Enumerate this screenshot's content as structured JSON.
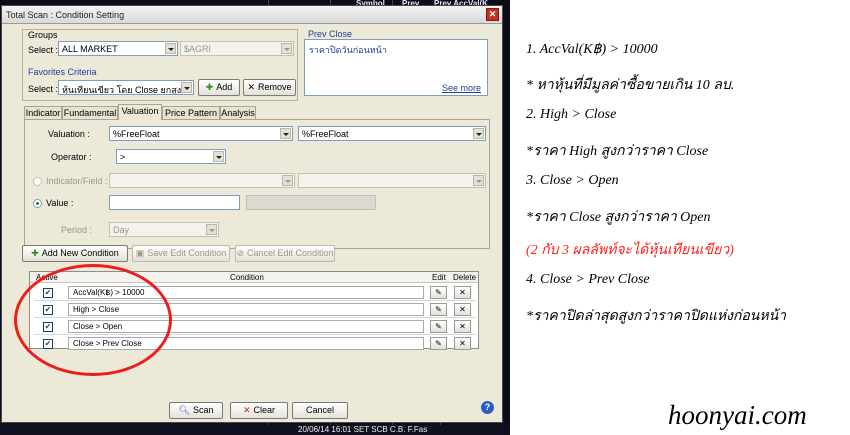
{
  "background_app": {
    "tabs": [
      "Symbol",
      "Prev",
      "Prev AccVal(K"
    ],
    "status_text": "20/06/14 16:01   SET   SCB   C.B. F.Fas"
  },
  "dialog": {
    "title": "Total Scan : Condition Setting",
    "groups": {
      "label": "Groups",
      "select_label": "Select :",
      "market_value": "ALL MARKET",
      "symbol_value": "$AGRI"
    },
    "favorites": {
      "label": "Favorites Criteria",
      "select_label": "Select :",
      "value": "หุ้นเทียนเขียว โดย Close ยกสูงขึ้",
      "add_label": "Add",
      "remove_label": "Remove"
    },
    "prev_close": {
      "label": "Prev Close",
      "description": "ราคาปิดวันก่อนหน้า",
      "see_more": "See more"
    },
    "tabs": [
      "Indicator",
      "Fundamental",
      "Valuation",
      "Price Pattern",
      "Analysis"
    ],
    "active_tab": "Valuation",
    "valuation_panel": {
      "valuation_label": "Valuation :",
      "valuation_left": "%FreeFloat",
      "valuation_right": "%FreeFloat",
      "operator_label": "Operator :",
      "operator_value": ">",
      "indicator_label": "Indicator/Field :",
      "value_label": "Value :",
      "value_input": "",
      "period_label": "Period :",
      "period_value": "Day"
    },
    "actions": {
      "add_new": "Add New Condition",
      "save_edit": "Save Edit Condition",
      "cancel_edit": "Cancel Edit Condition"
    },
    "grid": {
      "headers": {
        "active": "Active",
        "condition": "Condition",
        "edit": "Edit",
        "delete": "Delete"
      },
      "rows": [
        {
          "active": true,
          "condition": "AccVal(K฿) > 10000"
        },
        {
          "active": true,
          "condition": "High > Close"
        },
        {
          "active": true,
          "condition": "Close > Open"
        },
        {
          "active": true,
          "condition": "Close > Prev Close"
        }
      ]
    },
    "footer": {
      "scan": "Scan",
      "clear": "Clear",
      "cancel": "Cancel",
      "help": "?"
    }
  },
  "annotations": [
    {
      "text": "1. AccVal(K฿) > 10000",
      "style": "normal"
    },
    {
      "text": "* หาหุ้นที่มีมูลค่าซื้อขายเกิน 10 ลบ.",
      "style": "normal"
    },
    {
      "text": "2. High > Close",
      "style": "normal"
    },
    {
      "text": "*ราคา High สูงกว่าราคา Close",
      "style": "normal"
    },
    {
      "text": "3. Close > Open",
      "style": "normal"
    },
    {
      "text": "*ราคา Close สูงกว่าราคา Open",
      "style": "normal"
    },
    {
      "text": "(2 กับ 3 ผลลัพท์จะได้หุ้นเทียนเขียว)",
      "style": "red"
    },
    {
      "text": "4. Close > Prev Close",
      "style": "normal"
    },
    {
      "text": "*ราคาปิดล่าสุดสูงกว่าราคาปิดแห่งก่อนหน้า",
      "style": "normal"
    }
  ],
  "brand": "hoonyai.com",
  "colors": {
    "highlight_ring": "#ee1c1c",
    "annotation_red": "#ff2020"
  }
}
